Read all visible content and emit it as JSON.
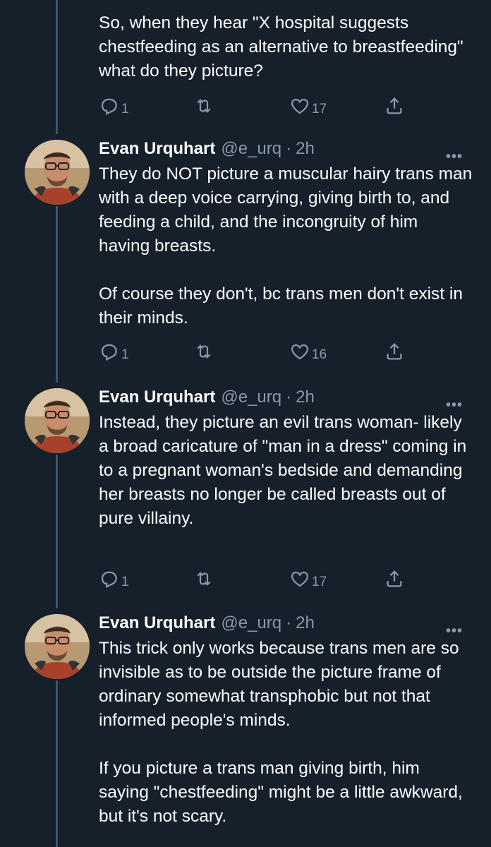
{
  "thread": {
    "intro": {
      "text": "So, when they hear \"X hospital suggests chestfeeding as an alternative to breastfeeding\" what do they picture?",
      "reply_count": "1",
      "like_count": "17"
    },
    "tweets": [
      {
        "name": "Evan Urquhart",
        "handle": "@e_urq",
        "separator": "·",
        "time": "2h",
        "more": "•••",
        "paragraphs": [
          "They do NOT picture a muscular hairy trans man with a deep voice carrying, giving birth to, and feeding a child, and the incongruity of him having breasts.",
          "Of course they don't, bc trans men don't exist in their minds."
        ],
        "reply_count": "1",
        "like_count": "16"
      },
      {
        "name": "Evan Urquhart",
        "handle": "@e_urq",
        "separator": "·",
        "time": "2h",
        "more": "•••",
        "paragraphs": [
          "Instead, they picture an evil trans woman- likely a broad caricature of \"man in a dress\" coming in to a pregnant woman's bedside and demanding her breasts no longer be called breasts out of pure villainy."
        ],
        "reply_count": "1",
        "like_count": "17"
      },
      {
        "name": "Evan Urquhart",
        "handle": "@e_urq",
        "separator": "·",
        "time": "2h",
        "more": "•••",
        "paragraphs": [
          "This trick only works because trans men are so invisible as to be outside the picture frame of ordinary somewhat transphobic but not that informed people's minds.",
          "If you picture a trans man giving birth, him saying \"chestfeeding\" might be a little awkward, but it's not scary."
        ]
      }
    ]
  },
  "icons": {
    "reply": "reply-icon",
    "retweet": "retweet-icon",
    "like": "heart-icon",
    "share": "share-icon",
    "more": "more-icon"
  },
  "colors": {
    "background": "#15202b",
    "secondary_text": "#8899a6",
    "thread_line": "#3d5466"
  }
}
